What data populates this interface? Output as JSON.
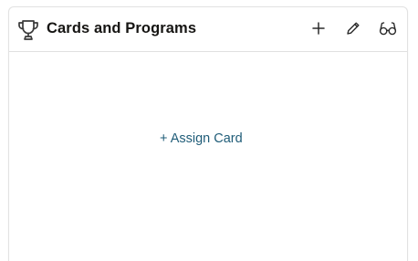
{
  "card": {
    "title": "Cards and Programs",
    "header_icon": "trophy-icon",
    "actions": [
      {
        "name": "add",
        "icon": "plus-icon"
      },
      {
        "name": "edit",
        "icon": "pencil-icon"
      },
      {
        "name": "view",
        "icon": "glasses-icon"
      }
    ],
    "assign_link_label": "+ Assign Card"
  },
  "colors": {
    "title": "#161513",
    "link": "#1f5c78",
    "border": "#e2e2e2",
    "icon": "#2b2b2b"
  }
}
